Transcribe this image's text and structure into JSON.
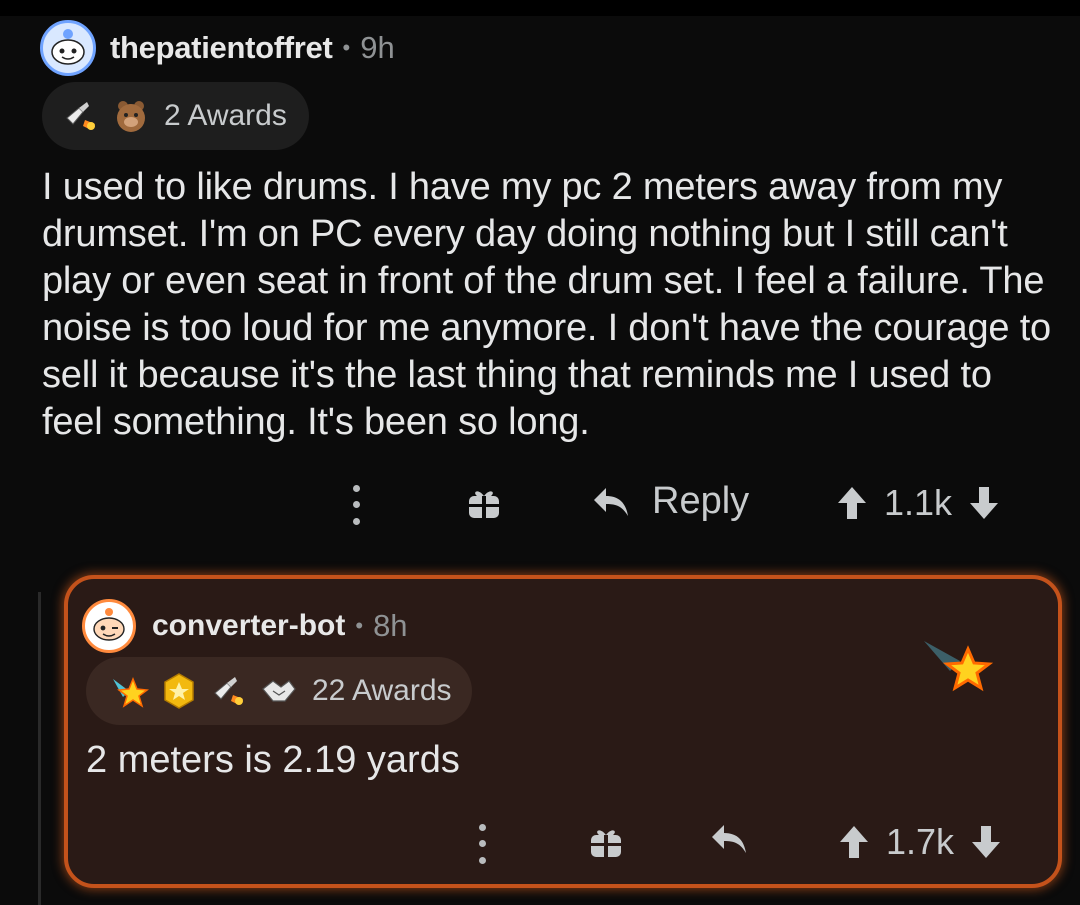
{
  "main_comment": {
    "username": "thepatientoffret",
    "separator": "•",
    "age": "9h",
    "awards_label": "2 Awards",
    "award_icons": [
      "helpful-rocket-icon",
      "bear-award-icon"
    ],
    "body": "I used to like drums. I have my pc 2 meters away from my drumset. I'm on PC every day doing nothing but I still can't play or even seat in front of the drum set. I feel a failure. The noise is too loud for me anymore. I don't have the courage to sell it because it's the last thing that reminds me I used to feel something. It's been so long.",
    "actions": {
      "reply_label": "Reply",
      "score": "1.1k"
    }
  },
  "reply_comment": {
    "username": "converter-bot",
    "separator": "•",
    "age": "8h",
    "awards_label": "22 Awards",
    "award_icons": [
      "starstruck-icon",
      "gold-award-icon",
      "helpful-rocket-icon",
      "handshake-icon"
    ],
    "body": "2 meters is 2.19 yards",
    "actions": {
      "score": "1.7k"
    },
    "highlight_color": "#c4521b"
  }
}
